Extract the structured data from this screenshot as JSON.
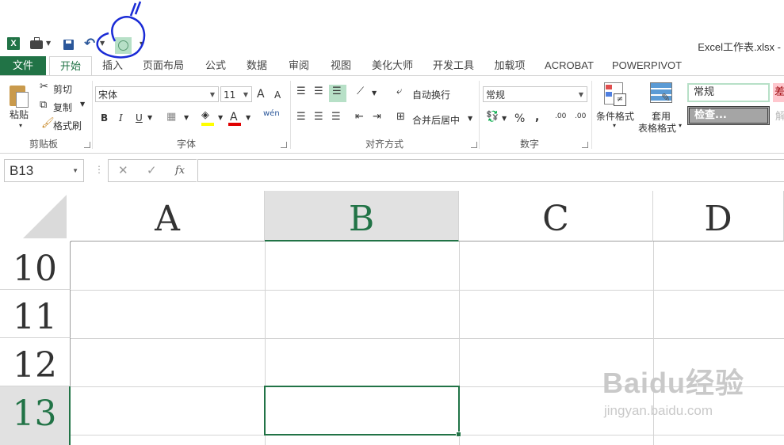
{
  "qat": {
    "excel_logo": "X",
    "icons": [
      "excel-icon",
      "briefcase-icon",
      "save-icon",
      "undo-icon",
      "circle-shape-icon"
    ]
  },
  "window": {
    "title": "Excel工作表.xlsx -"
  },
  "tabs": [
    {
      "label": "文件"
    },
    {
      "label": "开始"
    },
    {
      "label": "插入"
    },
    {
      "label": "页面布局"
    },
    {
      "label": "公式"
    },
    {
      "label": "数据"
    },
    {
      "label": "审阅"
    },
    {
      "label": "视图"
    },
    {
      "label": "美化大师"
    },
    {
      "label": "开发工具"
    },
    {
      "label": "加载项"
    },
    {
      "label": "ACROBAT"
    },
    {
      "label": "POWERPIVOT"
    }
  ],
  "ribbon": {
    "clipboard": {
      "paste": "粘贴",
      "cut": "剪切",
      "copy": "复制",
      "format_painter": "格式刷",
      "label": "剪贴板"
    },
    "font": {
      "name": "宋体",
      "size": "11",
      "grow": "A",
      "shrink": "A",
      "bold": "B",
      "italic": "I",
      "underline": "U",
      "phonetic": "wén",
      "label": "字体"
    },
    "alignment": {
      "wrap": "自动换行",
      "merge": "合并后居中",
      "label": "对齐方式"
    },
    "number": {
      "format": "常规",
      "percent": "%",
      "comma": ",",
      "inc": ".00",
      "label": "数字"
    },
    "styles": {
      "conditional": "条件格式",
      "table_format_1": "套用",
      "table_format_2": "表格格式",
      "style_normal": "常规",
      "style_check": "检查...",
      "style_bad": "差",
      "style_neutral": "解"
    }
  },
  "formula_bar": {
    "name_box": "B13",
    "cancel": "✕",
    "enter": "✓",
    "fx": "fx",
    "value": ""
  },
  "grid": {
    "columns": [
      "A",
      "B",
      "C",
      "D"
    ],
    "rows": [
      "10",
      "11",
      "12",
      "13"
    ],
    "selected_cell": "B13"
  },
  "watermark": {
    "brand": "Baidu经验",
    "url": "jingyan.baidu.com"
  },
  "colors": {
    "accent": "#217346",
    "annotation": "#1a2bd6"
  }
}
